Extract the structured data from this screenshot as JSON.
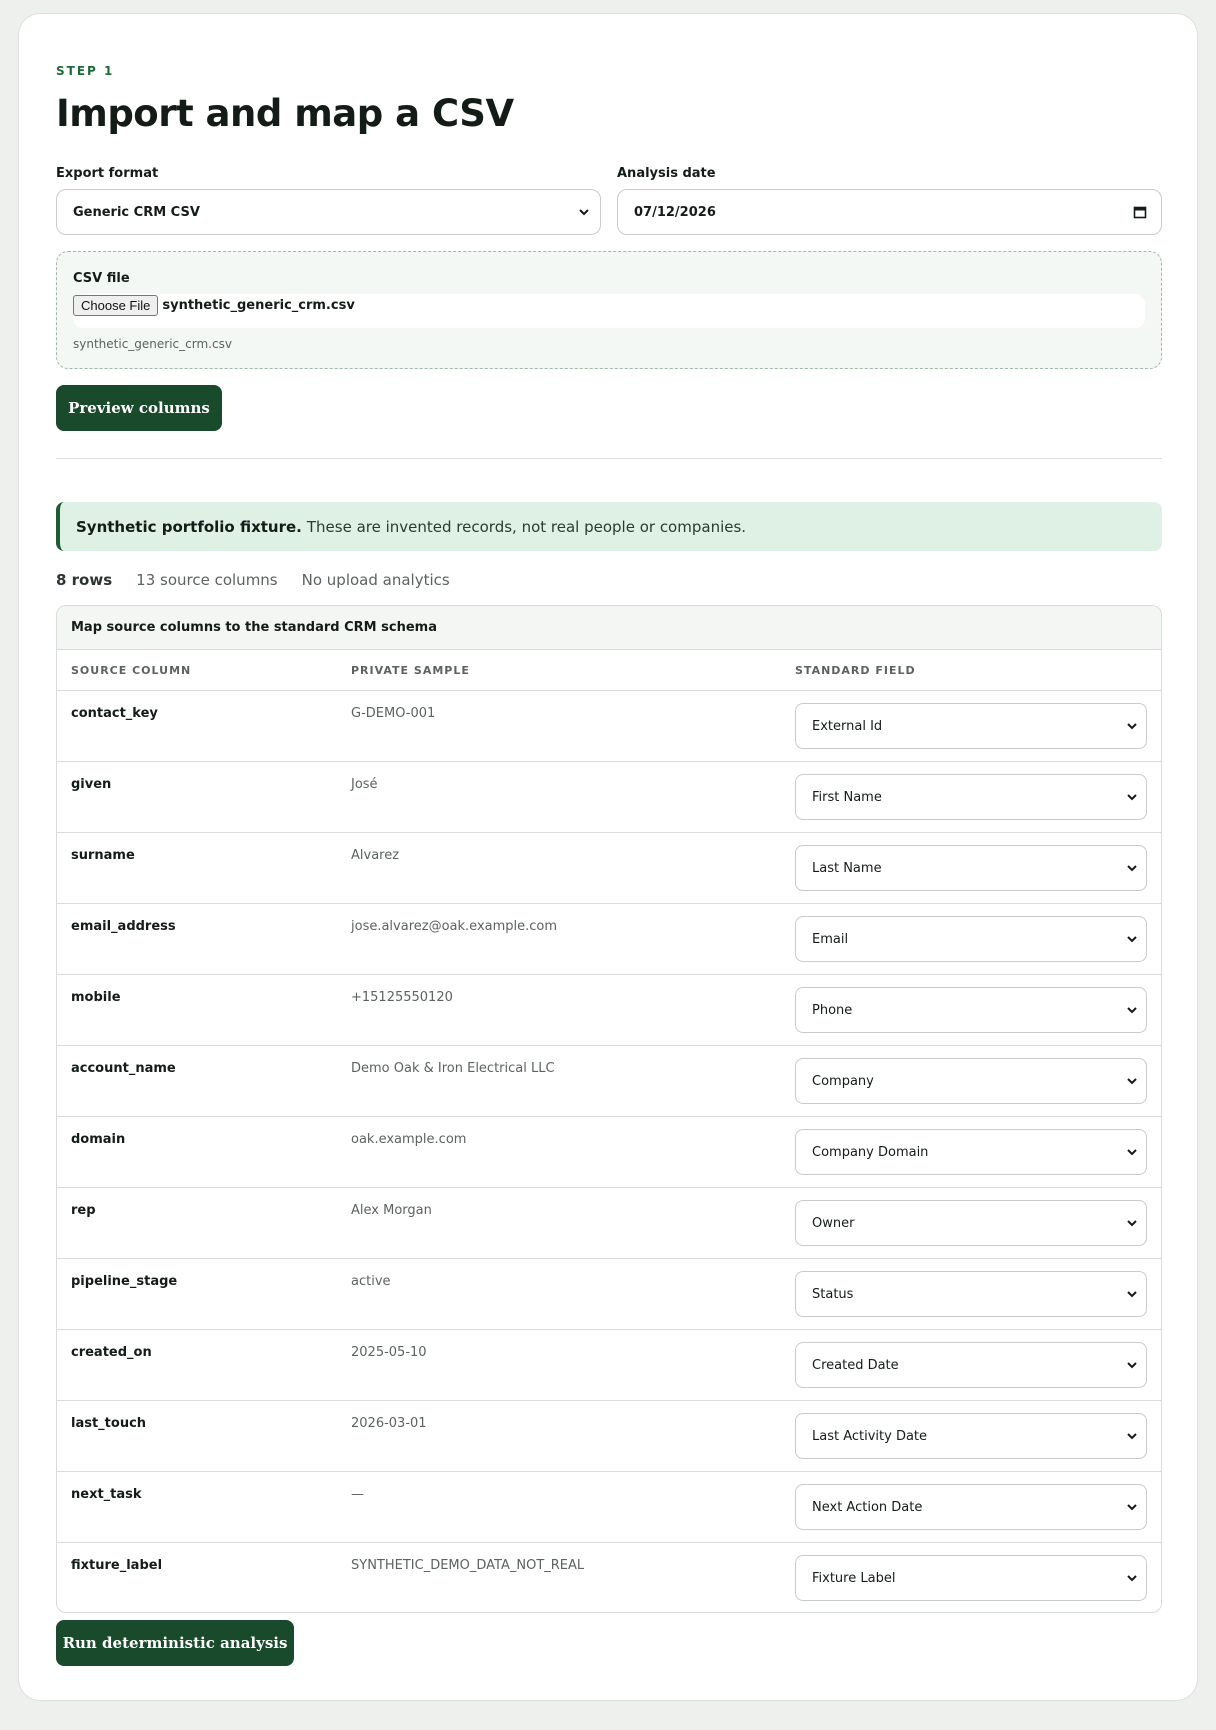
{
  "step": {
    "eyebrow": "STEP 1",
    "title": "Import and map a CSV"
  },
  "form": {
    "export_format_label": "Export format",
    "export_format_value": "Generic CRM CSV",
    "analysis_date_label": "Analysis date",
    "analysis_date_value": "07/12/2026",
    "csv_file_label": "CSV file",
    "choose_file_label": "Choose File",
    "file_name": "synthetic_generic_crm.csv",
    "file_hint": "synthetic_generic_crm.csv",
    "preview_button": "Preview columns"
  },
  "notice": {
    "bold": "Synthetic portfolio fixture.",
    "text": "These are invented records, not real people or companies."
  },
  "stats": {
    "rows": "8 rows",
    "columns": "13 source columns",
    "analytics": "No upload analytics"
  },
  "mapping": {
    "title": "Map source columns to the standard CRM schema",
    "headers": {
      "source": "SOURCE COLUMN",
      "sample": "PRIVATE SAMPLE",
      "field": "STANDARD FIELD"
    },
    "rows": [
      {
        "source": "contact_key",
        "sample": "G-DEMO-001",
        "field": "External Id"
      },
      {
        "source": "given",
        "sample": "José",
        "field": "First Name"
      },
      {
        "source": "surname",
        "sample": "Alvarez",
        "field": "Last Name"
      },
      {
        "source": "email_address",
        "sample": "jose.alvarez@oak.example.com",
        "field": "Email"
      },
      {
        "source": "mobile",
        "sample": "+15125550120",
        "field": "Phone"
      },
      {
        "source": "account_name",
        "sample": "Demo Oak & Iron Electrical LLC",
        "field": "Company"
      },
      {
        "source": "domain",
        "sample": "oak.example.com",
        "field": "Company Domain"
      },
      {
        "source": "rep",
        "sample": "Alex Morgan",
        "field": "Owner"
      },
      {
        "source": "pipeline_stage",
        "sample": "active",
        "field": "Status"
      },
      {
        "source": "created_on",
        "sample": "2025-05-10",
        "field": "Created Date"
      },
      {
        "source": "last_touch",
        "sample": "2026-03-01",
        "field": "Last Activity Date"
      },
      {
        "source": "next_task",
        "sample": "—",
        "field": "Next Action Date"
      },
      {
        "source": "fixture_label",
        "sample": "SYNTHETIC_DEMO_DATA_NOT_REAL",
        "field": "Fixture Label"
      }
    ]
  },
  "run_button": "Run deterministic analysis",
  "colors": {
    "primary": "#1a4a2c",
    "accent": "#1f6b3a",
    "notice_bg": "#dff0e4"
  }
}
